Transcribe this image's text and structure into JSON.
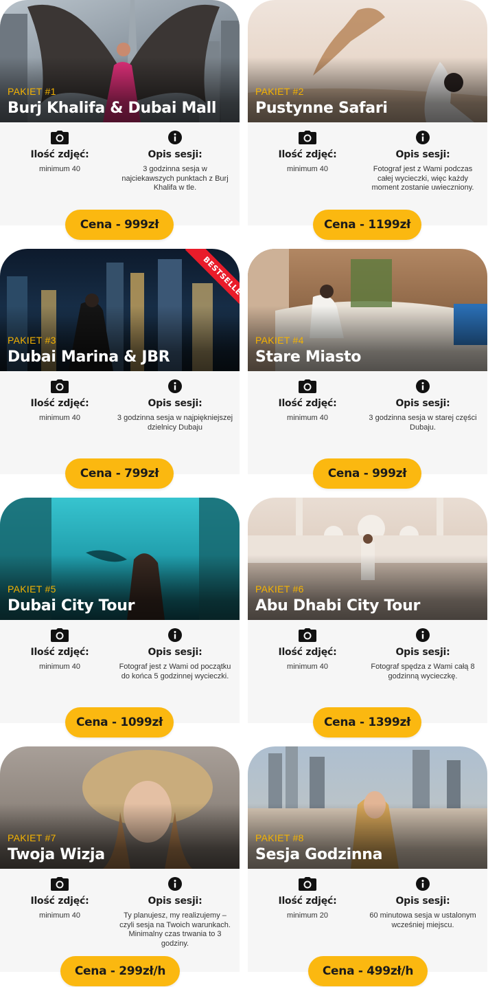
{
  "labels": {
    "photos_heading": "Ilość zdjęć:",
    "description_heading": "Opis sesji:",
    "camera_icon": "camera-icon",
    "info_icon": "info-icon"
  },
  "colors": {
    "accent": "#fbb810",
    "badge": "#e91c2a",
    "panel": "#f6f6f6"
  },
  "packages": [
    {
      "number": "PAKIET #1",
      "title": "Burj Khalifa & Dubai Mall",
      "photos": "minimum 40",
      "description": "3 godzinna sesja w najciekawszych punktach z Burj Khalifa w tle.",
      "price": "Cena - 999zł"
    },
    {
      "number": "PAKIET #2",
      "title": "Pustynne Safari",
      "photos": "minimum 40",
      "description": "Fotograf jest z Wami podczas całej wycieczki, więc każdy moment zostanie uwieczniony.",
      "price": "Cena - 1199zł"
    },
    {
      "number": "PAKIET #3",
      "title": "Dubai Marina & JBR",
      "photos": "minimum 40",
      "description": "3 godzinna sesja w najpiękniejszej dzielnicy Dubaju",
      "price": "Cena - 799zł",
      "badge": "BESTSELLER"
    },
    {
      "number": "PAKIET #4",
      "title": "Stare Miasto",
      "photos": "minimum 40",
      "description": "3 godzinna sesja w starej części Dubaju.",
      "price": "Cena - 999zł"
    },
    {
      "number": "PAKIET #5",
      "title": "Dubai City Tour",
      "photos": "minimum 40",
      "description": "Fotograf jest z Wami od początku do końca 5 godzinnej wycieczki.",
      "price": "Cena - 1099zł"
    },
    {
      "number": "PAKIET #6",
      "title": "Abu Dhabi City Tour",
      "photos": "minimum 40",
      "description": "Fotograf spędza z Wami całą 8 godzinną wycieczkę.",
      "price": "Cena - 1399zł"
    },
    {
      "number": "PAKIET #7",
      "title": "Twoja Wizja",
      "photos": "minimum 40",
      "description": "Ty planujesz, my realizujemy – czyli sesja na Twoich warunkach. Minimalny czas trwania to 3 godziny.",
      "price": "Cena - 299zł/h"
    },
    {
      "number": "PAKIET #8",
      "title": "Sesja Godzinna",
      "photos": "minimum 20",
      "description": "60 minutowa sesja w ustalonym wcześniej miejscu.",
      "price": "Cena - 499zł/h"
    }
  ]
}
